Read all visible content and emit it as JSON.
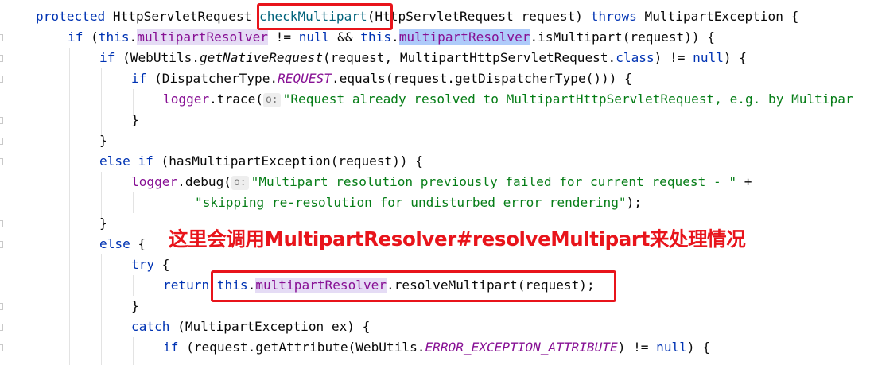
{
  "code": {
    "l1": {
      "kw_protected": "protected",
      "type": "HttpServletRequest ",
      "method": "checkMultipart",
      "params": "(HttpServletRequest request) ",
      "kw_throws": "throws",
      "tail": " MultipartException {"
    },
    "l2": {
      "kw_if": "if",
      "p1": " (",
      "kw_this1": "this",
      "dot1": ".",
      "field1": "multipartResolver",
      "p2": " != ",
      "kw_null": "null",
      "p3": " && ",
      "kw_this2": "this",
      "dot2": ".",
      "field2": "multipartResolver",
      "p4": ".isMultipart(request)) {"
    },
    "l3": {
      "kw_if": "if",
      "p1": " (WebUtils.",
      "method": "getNativeRequest",
      "p2": "(request, MultipartHttpServletRequest.",
      "kw_class": "class",
      "p3": ") != ",
      "kw_null": "null",
      "p4": ") {"
    },
    "l4": {
      "kw_if": "if",
      "p1": " (DispatcherType.",
      "field": "REQUEST",
      "p2": ".equals(request.getDispatcherType())) {"
    },
    "l5": {
      "field": "logger",
      "p1": ".trace(",
      "hint": "o:",
      "string": "\"Request already resolved to MultipartHttpServletRequest, e.g. by Multipar"
    },
    "l6": {
      "text": "}"
    },
    "l7": {
      "text": "}"
    },
    "l8": {
      "kw_else": "else",
      "kw_if": "if",
      "p1": " (hasMultipartException(request)) {"
    },
    "l9": {
      "field": "logger",
      "p1": ".debug(",
      "hint": "o:",
      "string": "\"Multipart resolution previously failed for current request - \"",
      "p2": " +"
    },
    "l10": {
      "string": "\"skipping re-resolution for undisturbed error rendering\"",
      "p1": ");"
    },
    "l11": {
      "text": "}"
    },
    "l12": {
      "kw_else": "else",
      "p1": " {"
    },
    "l13": {
      "kw_try": "try",
      "p1": " {"
    },
    "l14": {
      "kw_return": "return",
      "kw_this": "this",
      "dot": ".",
      "field": "multipartResolver",
      "p1": ".resolveMultipart(request);"
    },
    "l15": {
      "text": "}"
    },
    "l16": {
      "kw_catch": "catch",
      "p1": " (MultipartException ex) {"
    },
    "l17": {
      "kw_if": "if",
      "p1": " (request.getAttribute(WebUtils.",
      "field": "ERROR_EXCEPTION_ATTRIBUTE",
      "p2": ") != ",
      "kw_null": "null",
      "p3": ") {"
    }
  },
  "annotation": {
    "text": "这里会调用MultipartResolver#resolveMultipart来处理情况"
  },
  "colors": {
    "keyword": "#0033b3",
    "field": "#871094",
    "string": "#067d17",
    "annotation": "#e8141b",
    "highlight": "#aecbfa"
  }
}
